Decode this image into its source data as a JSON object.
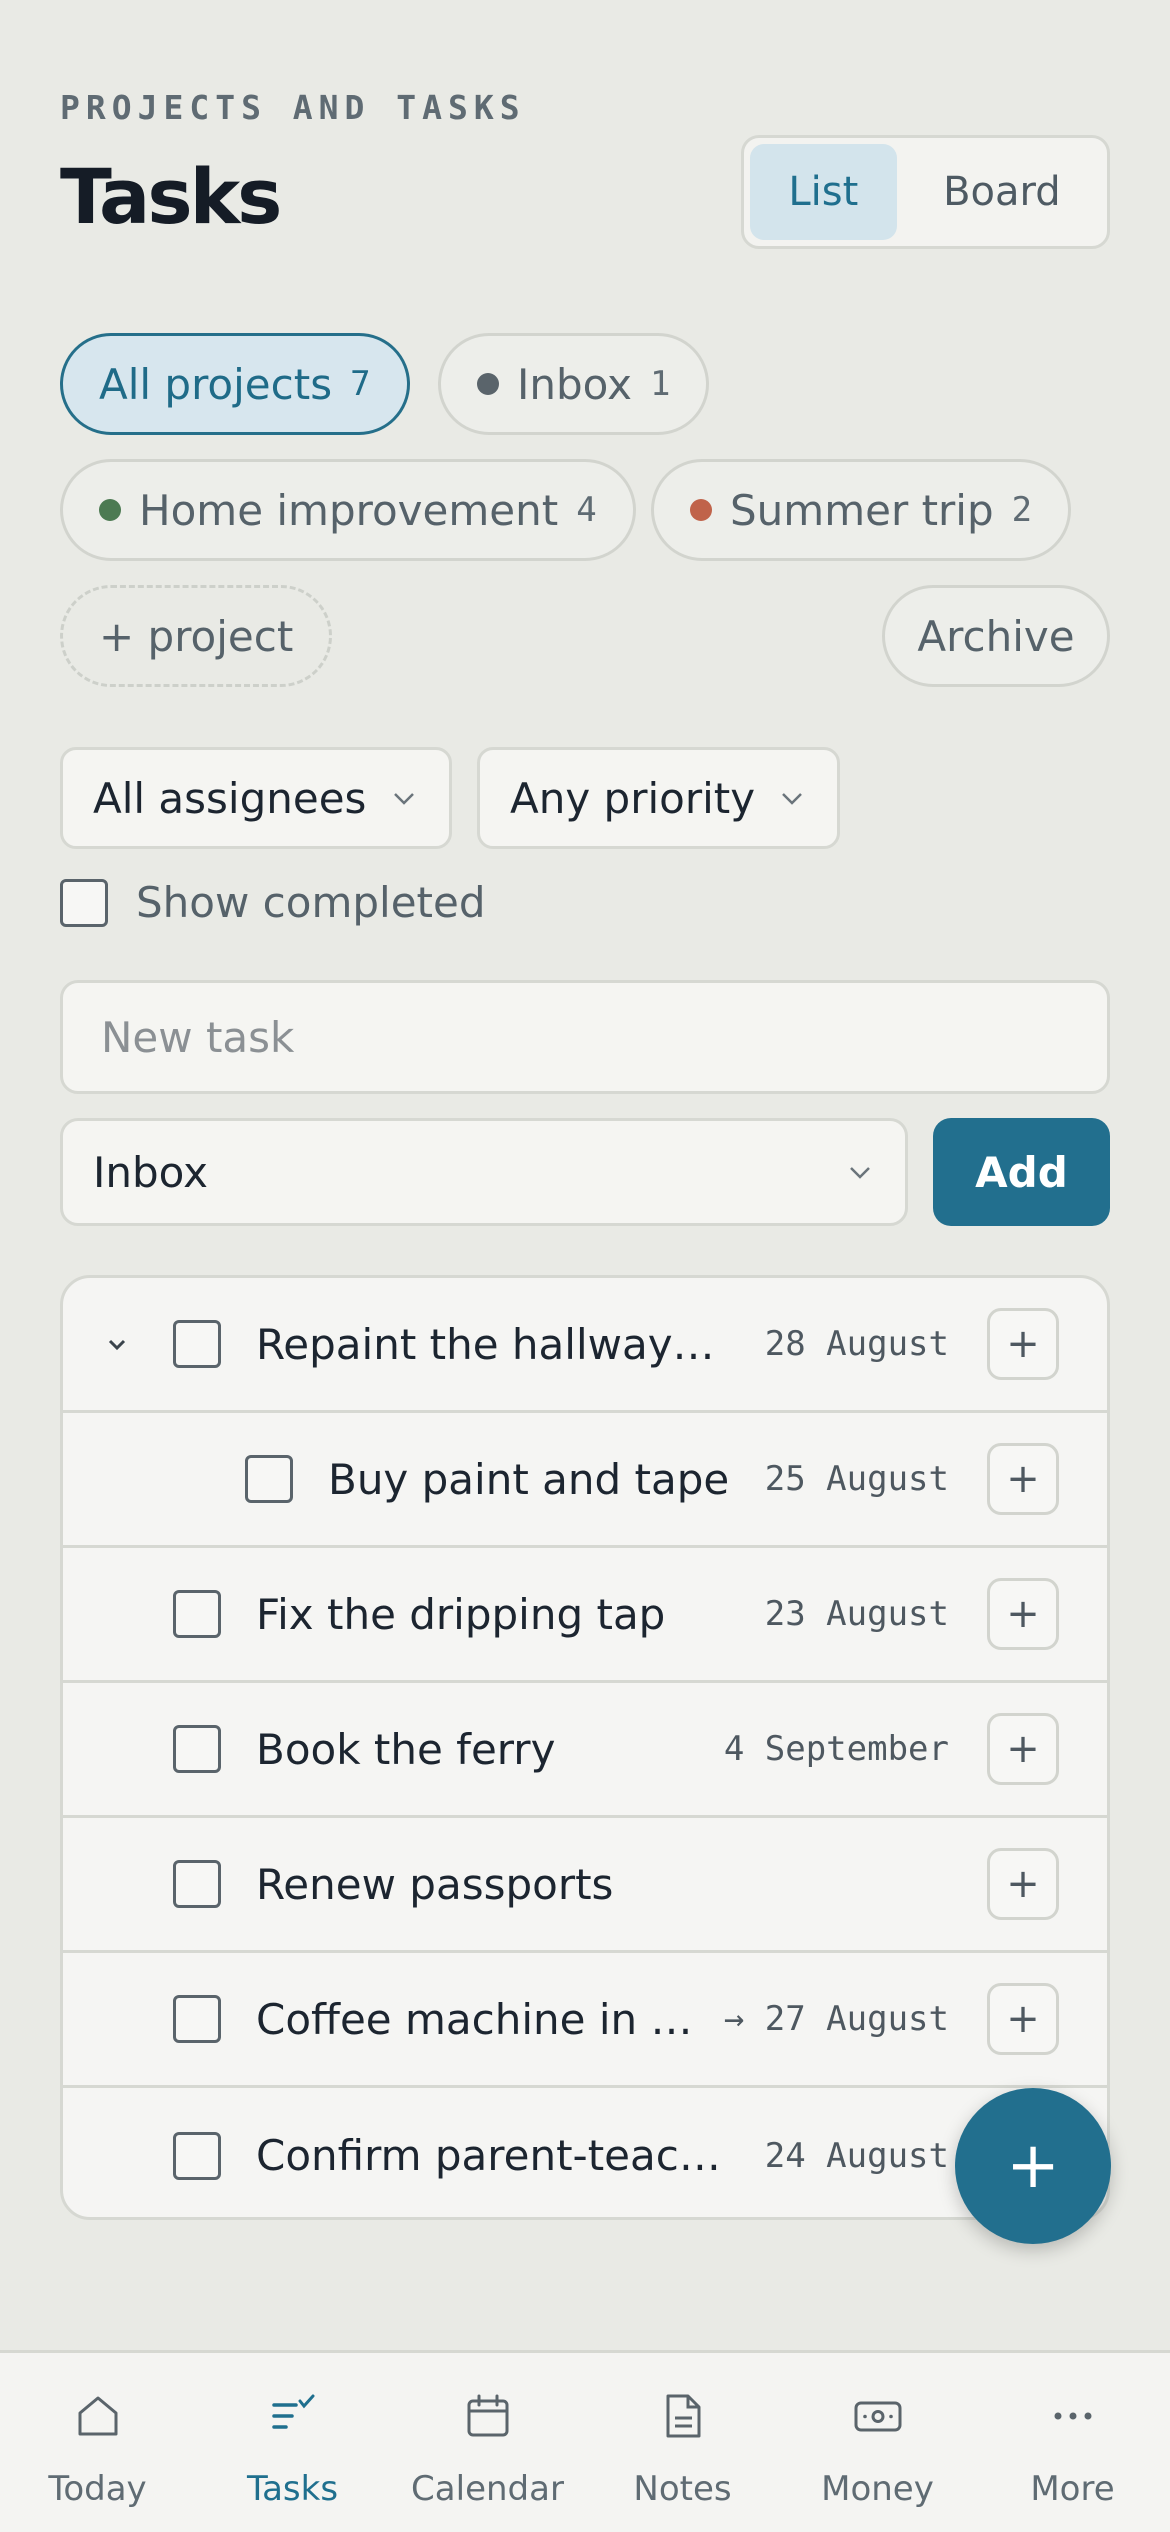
{
  "header": {
    "eyebrow": "PROJECTS AND TASKS",
    "title": "Tasks",
    "view_toggle": {
      "list": "List",
      "board": "Board",
      "selected": "List"
    }
  },
  "projects": [
    {
      "label": "All projects",
      "count": "7",
      "active": true
    },
    {
      "label": "Inbox",
      "count": "1",
      "dot": "#5a646b"
    },
    {
      "label": "Home improvement",
      "count": "4",
      "dot": "#4c7a52"
    },
    {
      "label": "Summer trip",
      "count": "2",
      "dot": "#c0634a"
    }
  ],
  "project_actions": {
    "add": "+ project",
    "archive": "Archive"
  },
  "filters": {
    "assignee": "All assignees",
    "priority": "Any priority",
    "show_completed_label": "Show completed",
    "show_completed": false
  },
  "composer": {
    "placeholder": "New task",
    "project_select": "Inbox",
    "add_label": "Add"
  },
  "tasks": [
    {
      "name": "Repaint the hallway…",
      "date": "28 August",
      "expandable": true,
      "indent": 0
    },
    {
      "name": "Buy paint and tape",
      "date": "25 August",
      "indent": 1
    },
    {
      "name": "Fix the dripping tap",
      "date": "23 August",
      "indent": 0
    },
    {
      "name": "Book the ferry",
      "date": "4 September",
      "indent": 0
    },
    {
      "name": "Renew passports",
      "date": "",
      "indent": 0
    },
    {
      "name": "Coffee machine in …",
      "date": "→ 27 August",
      "indent": 0
    },
    {
      "name": "Confirm parent-teac…",
      "date": "24 August",
      "indent": 0
    }
  ],
  "row_add_label": "+",
  "fab_label": "+",
  "tabbar": [
    {
      "label": "Today",
      "icon": "home-icon"
    },
    {
      "label": "Tasks",
      "icon": "tasks-icon",
      "active": true
    },
    {
      "label": "Calendar",
      "icon": "calendar-icon"
    },
    {
      "label": "Notes",
      "icon": "notes-icon"
    },
    {
      "label": "Money",
      "icon": "money-icon"
    },
    {
      "label": "More",
      "icon": "more-icon"
    }
  ],
  "colors": {
    "accent": "#226f8e",
    "background": "#e9eae5"
  }
}
